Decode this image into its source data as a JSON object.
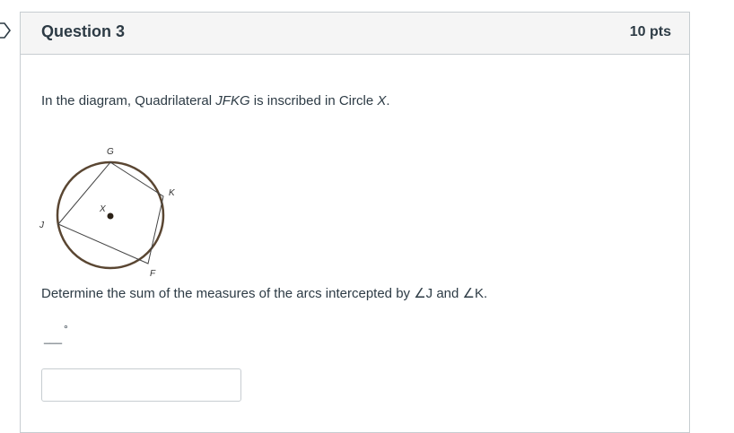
{
  "question": {
    "title": "Question 3",
    "points": "10 pts",
    "text_prefix": "In the diagram, Quadrilateral ",
    "text_figure": "JFKG",
    "text_middle": " is inscribed in Circle ",
    "text_circle": "X",
    "text_end": ".",
    "prompt": "Determine the sum of the measures of the arcs intercepted by ∠J and ∠K.",
    "blank": "___",
    "degree_symbol": "°",
    "answer_value": ""
  },
  "diagram": {
    "labels": {
      "G": "G",
      "K": "K",
      "J": "J",
      "F": "F",
      "X": "X"
    },
    "colors": {
      "circle": "#5a4632",
      "lines": "#444444",
      "center_dot": "#2b2116"
    }
  },
  "colors": {
    "header_bg": "#f5f5f5",
    "border": "#c7cdd1",
    "text": "#2d3b45"
  }
}
